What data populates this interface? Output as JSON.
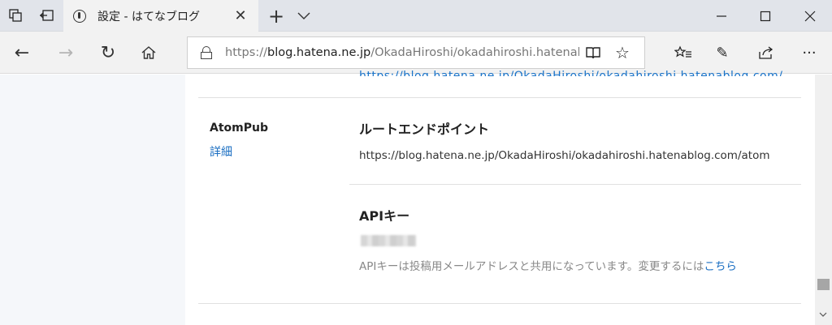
{
  "tab": {
    "title": "設定 - はてなブログ",
    "close_glyph": "✕"
  },
  "titlebar": {
    "new_tab_glyph": "+",
    "minimize_glyph": "—",
    "maximize_glyph": "☐",
    "close_glyph": "✕"
  },
  "nav": {
    "back_glyph": "←",
    "forward_glyph": "→",
    "refresh_glyph": "↻",
    "home_glyph": "⌂"
  },
  "address": {
    "scheme": "https://",
    "host": "blog.hatena.ne.jp",
    "path": "/OkadaHiroshi/okadahiroshi.hatenablo",
    "reading_view_glyph": "📖",
    "favorite_glyph": "☆"
  },
  "tools": {
    "favorites_glyph": "☆",
    "notes_glyph": "✎",
    "share_glyph": "⇪",
    "more_glyph": "···"
  },
  "content": {
    "top_link_partial": "https://blog.hatena.ne.jp/OkadaHiroshi/okadahiroshi.hatenablog.com/",
    "section_label": "AtomPub",
    "section_link": "詳細",
    "root_endpoint_heading": "ルートエンドポイント",
    "root_endpoint_url": "https://blog.hatena.ne.jp/OkadaHiroshi/okadahiroshi.hatenablog.com/atom",
    "api_key_heading": "APIキー",
    "api_key_note": "APIキーは投稿用メールアドレスと共用になっています。変更するには",
    "api_key_note_link": "こちら"
  },
  "colors": {
    "link": "#1a6ec2",
    "titlebar": "#e1e4ea",
    "left_pane": "#f5f7fa"
  }
}
